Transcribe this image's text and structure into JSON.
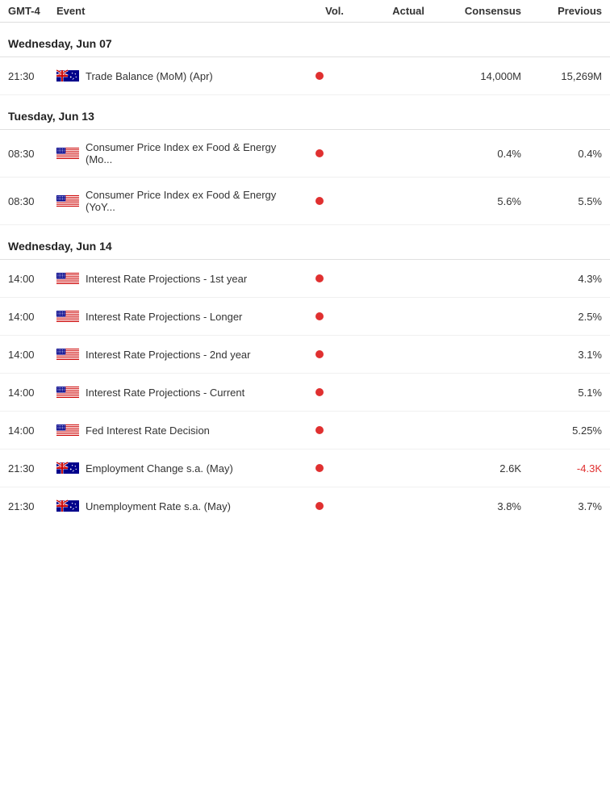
{
  "header": {
    "timezone": "GMT-4",
    "event": "Event",
    "vol": "Vol.",
    "actual": "Actual",
    "consensus": "Consensus",
    "previous": "Previous"
  },
  "sections": [
    {
      "id": "section-wed-jun07",
      "label": "Wednesday, Jun 07",
      "events": [
        {
          "id": "event-trade-balance",
          "time": "21:30",
          "country": "AU",
          "name": "Trade Balance (MoM) (Apr)",
          "hasVol": true,
          "actual": "",
          "consensus": "14,000M",
          "previous": "15,269M",
          "previousNegative": false
        }
      ]
    },
    {
      "id": "section-tue-jun13",
      "label": "Tuesday, Jun 13",
      "events": [
        {
          "id": "event-cpi-ex-food-mo",
          "time": "08:30",
          "country": "US",
          "name": "Consumer Price Index ex Food & Energy (Mo...",
          "hasVol": true,
          "actual": "",
          "consensus": "0.4%",
          "previous": "0.4%",
          "previousNegative": false
        },
        {
          "id": "event-cpi-ex-food-yoy",
          "time": "08:30",
          "country": "US",
          "name": "Consumer Price Index ex Food & Energy (YoY...",
          "hasVol": true,
          "actual": "",
          "consensus": "5.6%",
          "previous": "5.5%",
          "previousNegative": false
        }
      ]
    },
    {
      "id": "section-wed-jun14",
      "label": "Wednesday, Jun 14",
      "events": [
        {
          "id": "event-ir-proj-1st",
          "time": "14:00",
          "country": "US",
          "name": "Interest Rate Projections - 1st year",
          "hasVol": true,
          "actual": "",
          "consensus": "",
          "previous": "4.3%",
          "previousNegative": false
        },
        {
          "id": "event-ir-proj-longer",
          "time": "14:00",
          "country": "US",
          "name": "Interest Rate Projections - Longer",
          "hasVol": true,
          "actual": "",
          "consensus": "",
          "previous": "2.5%",
          "previousNegative": false
        },
        {
          "id": "event-ir-proj-2nd",
          "time": "14:00",
          "country": "US",
          "name": "Interest Rate Projections - 2nd year",
          "hasVol": true,
          "actual": "",
          "consensus": "",
          "previous": "3.1%",
          "previousNegative": false
        },
        {
          "id": "event-ir-proj-current",
          "time": "14:00",
          "country": "US",
          "name": "Interest Rate Projections - Current",
          "hasVol": true,
          "actual": "",
          "consensus": "",
          "previous": "5.1%",
          "previousNegative": false
        },
        {
          "id": "event-fed-rate",
          "time": "14:00",
          "country": "US",
          "name": "Fed Interest Rate Decision",
          "hasVol": true,
          "actual": "",
          "consensus": "",
          "previous": "5.25%",
          "previousNegative": false
        },
        {
          "id": "event-employment-change",
          "time": "21:30",
          "country": "AU",
          "name": "Employment Change s.a. (May)",
          "hasVol": true,
          "actual": "",
          "consensus": "2.6K",
          "previous": "-4.3K",
          "previousNegative": true
        },
        {
          "id": "event-unemployment-rate",
          "time": "21:30",
          "country": "AU",
          "name": "Unemployment Rate s.a. (May)",
          "hasVol": true,
          "actual": "",
          "consensus": "3.8%",
          "previous": "3.7%",
          "previousNegative": false
        }
      ]
    }
  ]
}
